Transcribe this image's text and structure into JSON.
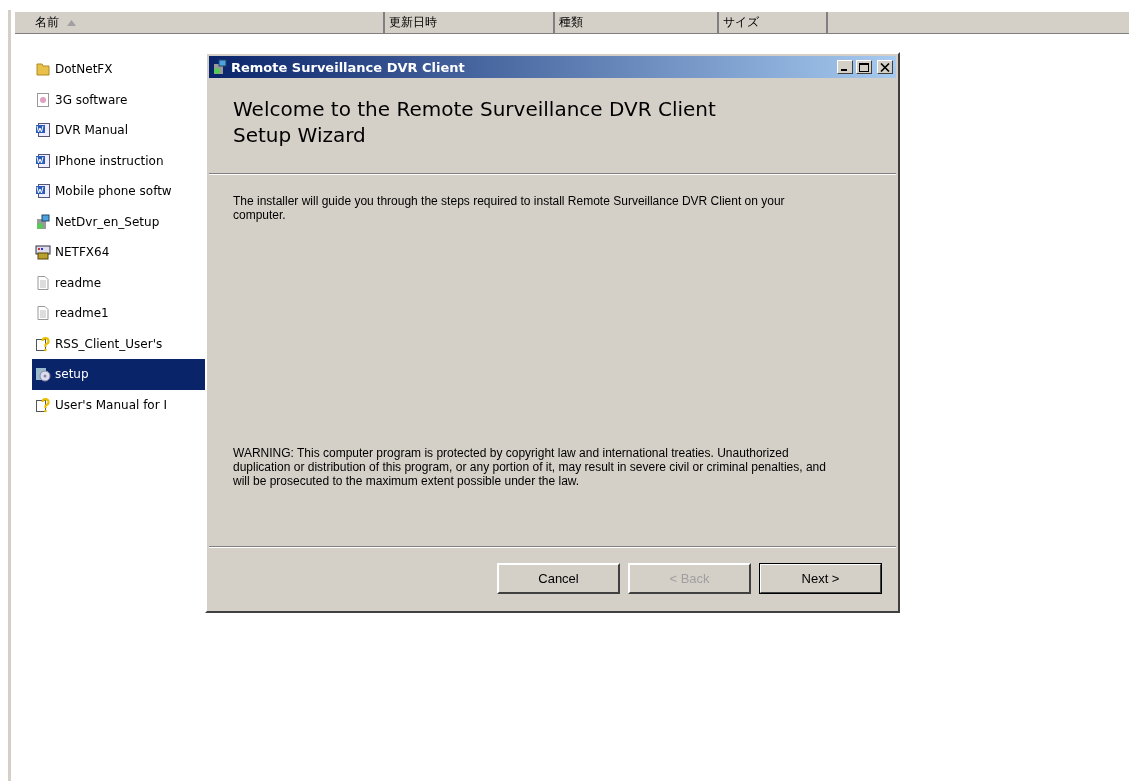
{
  "columns": [
    {
      "label": "名前",
      "sorted": true
    },
    {
      "label": "更新日時",
      "sorted": false
    },
    {
      "label": "種類",
      "sorted": false
    },
    {
      "label": "サイズ",
      "sorted": false
    }
  ],
  "files": [
    {
      "name": "DotNetFX",
      "kind": "folder",
      "selected": false
    },
    {
      "name": "3G software",
      "kind": "image",
      "selected": false
    },
    {
      "name": "DVR Manual",
      "kind": "word",
      "selected": false
    },
    {
      "name": "IPhone instruction",
      "kind": "word",
      "selected": false
    },
    {
      "name": "Mobile phone softw",
      "kind": "word",
      "selected": false
    },
    {
      "name": "NetDvr_en_Setup",
      "kind": "installer",
      "selected": false
    },
    {
      "name": "NETFX64",
      "kind": "package",
      "selected": false
    },
    {
      "name": "readme",
      "kind": "text",
      "selected": false
    },
    {
      "name": "readme1",
      "kind": "text",
      "selected": false
    },
    {
      "name": "RSS_Client_User's",
      "kind": "help",
      "selected": false
    },
    {
      "name": "setup",
      "kind": "setup",
      "selected": true
    },
    {
      "name": "User's Manual for I",
      "kind": "help",
      "selected": false
    }
  ],
  "dialog": {
    "title": "Remote Surveillance DVR Client",
    "heading": "Welcome to the Remote Surveillance DVR Client Setup Wizard",
    "intro": "The installer will guide you through the steps required to install Remote Surveillance DVR Client on your computer.",
    "warning": "WARNING: This computer program is protected by copyright law and international treaties. Unauthorized duplication or distribution of this program, or any portion of it, may result in severe civil or criminal penalties, and will be prosecuted to the maximum extent possible under the law.",
    "buttons": [
      {
        "label": "Cancel",
        "disabled": false,
        "default": false
      },
      {
        "label": "< Back",
        "disabled": true,
        "default": false
      },
      {
        "label": "Next >",
        "disabled": false,
        "default": true
      }
    ]
  }
}
